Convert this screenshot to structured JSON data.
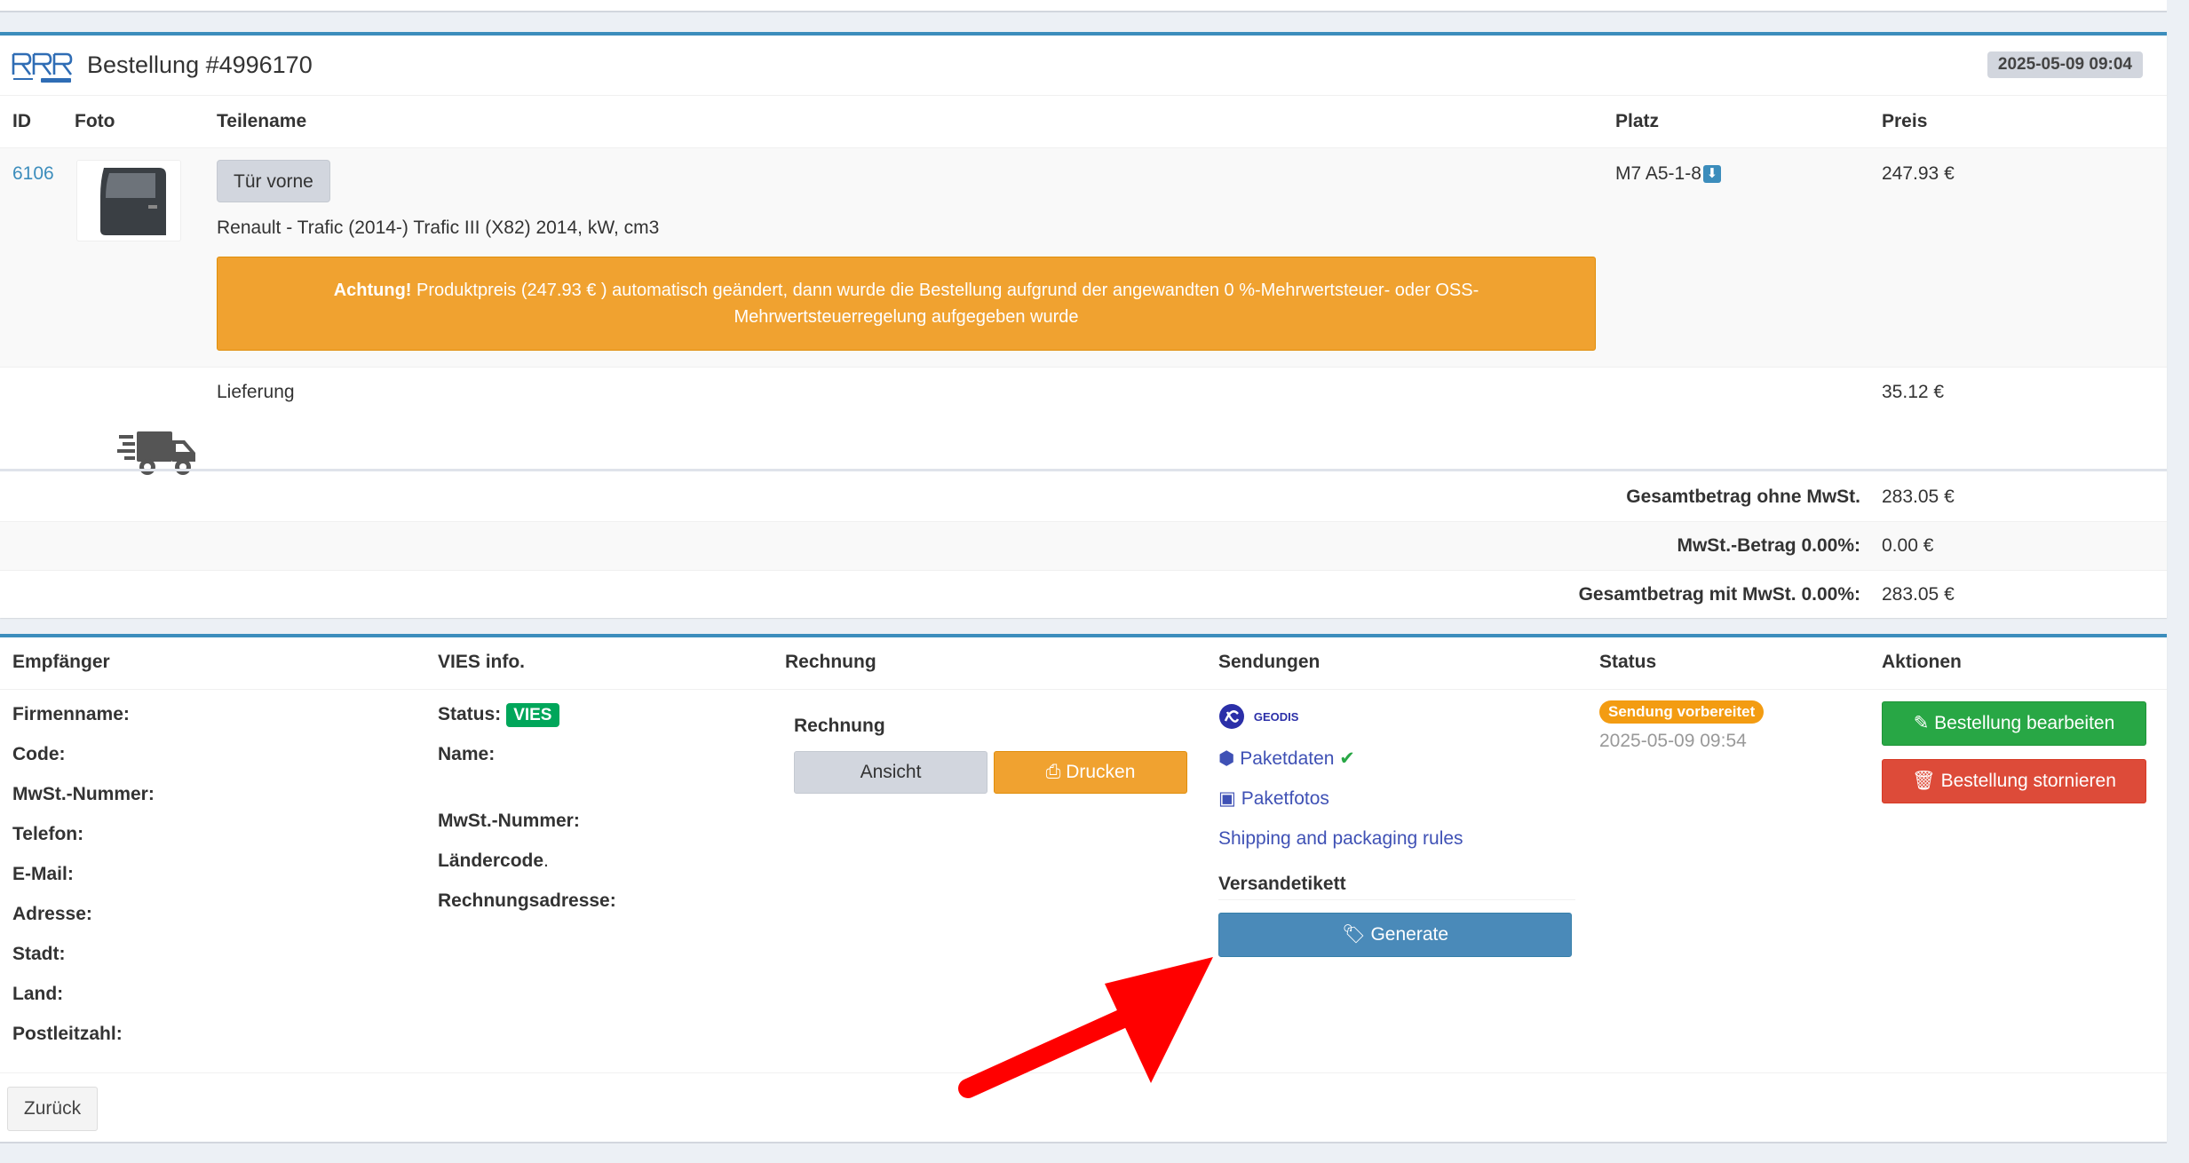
{
  "order": {
    "title": "Bestellung #4996170",
    "date": "2025-05-09 09:04",
    "brand_logo": "rrr-ovoko-logo",
    "columns": {
      "id": "ID",
      "photo": "Foto",
      "part_name": "Teilename",
      "place": "Platz",
      "price": "Preis"
    },
    "item": {
      "id": "6106",
      "part_button": "Tür vorne",
      "vehicle": "Renault - Trafic (2014-) Trafic III (X82) 2014, kW, cm3",
      "place": "M7 A5-1-8",
      "price": "247.93 €",
      "alert_strong": "Achtung!",
      "alert_text": " Produktpreis (247.93 € ) automatisch geändert, dann wurde die Bestellung aufgrund der angewandten 0 %-Mehrwertsteuer- oder OSS-Mehrwertsteuerregelung aufgegeben wurde"
    },
    "delivery": {
      "label": "Lieferung",
      "price": "35.12 €"
    },
    "totals": [
      {
        "label": "Gesamtbetrag ohne MwSt.",
        "value": "283.05 €"
      },
      {
        "label": "MwSt.-Betrag 0.00%:",
        "value": "0.00 €"
      },
      {
        "label": "Gesamtbetrag mit MwSt. 0.00%:",
        "value": "283.05 €"
      }
    ]
  },
  "details": {
    "headers": {
      "recipient": "Empfänger",
      "vies": "VIES info.",
      "invoice": "Rechnung",
      "shipments": "Sendungen",
      "status": "Status",
      "actions": "Aktionen"
    },
    "recipient_fields": [
      "Firmenname:",
      "Code:",
      "MwSt.-Nummer:",
      "Telefon:",
      "E-Mail:",
      "Adresse:",
      "Stadt:",
      "Land:",
      "Postleitzahl:"
    ],
    "vies": {
      "status_label": "Status:",
      "status_badge": "VIES",
      "name_label": "Name:",
      "vat_label": "MwSt.-Nummer:",
      "country_label": "Ländercode",
      "country_dot": ".",
      "billing_label": "Rechnungsadresse:"
    },
    "invoice": {
      "title": "Rechnung",
      "view_button": "Ansicht",
      "print_button": "Drucken"
    },
    "shipments": {
      "carrier_name": "GEODIS",
      "package_data": "Paketdaten",
      "package_photos": "Paketfotos",
      "rules_link": "Shipping and packaging rules",
      "label_title": "Versandetikett",
      "generate_button": "Generate"
    },
    "status": {
      "badge": "Sendung vorbereitet",
      "timestamp": "2025-05-09 09:54"
    },
    "actions": {
      "edit_button": "Bestellung bearbeiten",
      "cancel_button": "Bestellung stornieren"
    },
    "back_button": "Zurück"
  },
  "colors": {
    "accent": "#3c8dbc",
    "warning": "#f0a230",
    "success": "#28a745",
    "danger": "#dd4b39",
    "annotation_arrow": "#ff0000"
  }
}
